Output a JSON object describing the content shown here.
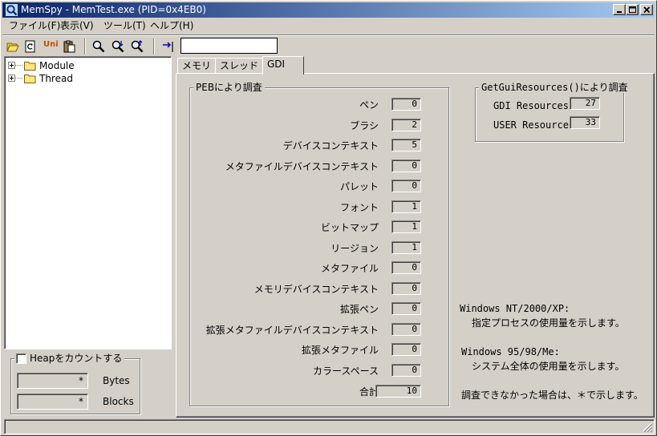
{
  "window": {
    "title": "MemSpy - MemTest.exe (PID=0x4EB0)"
  },
  "menu": [
    {
      "label": "ファイル(F)"
    },
    {
      "label": "表示(V)"
    },
    {
      "label": "ツール(T)"
    },
    {
      "label": "ヘルプ(H)"
    }
  ],
  "toolbar": {
    "icons": [
      "open-folder-icon",
      "refresh-icon",
      "unicode-icon",
      "paste-icon",
      "find-icon",
      "find-next-icon",
      "find-prev-icon",
      "goto-icon"
    ],
    "unicode_label": "Uni",
    "search_value": ""
  },
  "tree": {
    "items": [
      {
        "label": "Module"
      },
      {
        "label": "Thread"
      }
    ]
  },
  "heap": {
    "checkbox_label": "Heapをカウントする",
    "checked": false,
    "bytes_value": "*",
    "bytes_unit": "Bytes",
    "blocks_value": "*",
    "blocks_unit": "Blocks"
  },
  "tabs": [
    {
      "label": "メモリ",
      "active": false
    },
    {
      "label": "スレッド",
      "active": false
    },
    {
      "label": "GDI",
      "active": true
    }
  ],
  "peb_group": {
    "title": "PEBにより調査",
    "rows": [
      {
        "label": "ペン",
        "value": "0"
      },
      {
        "label": "ブラシ",
        "value": "2"
      },
      {
        "label": "デバイスコンテキスト",
        "value": "5"
      },
      {
        "label": "メタファイルデバイスコンテキスト",
        "value": "0"
      },
      {
        "label": "パレット",
        "value": "0"
      },
      {
        "label": "フォント",
        "value": "1"
      },
      {
        "label": "ビットマップ",
        "value": "1"
      },
      {
        "label": "リージョン",
        "value": "1"
      },
      {
        "label": "メタファイル",
        "value": "0"
      },
      {
        "label": "メモリデバイスコンテキスト",
        "value": "0"
      },
      {
        "label": "拡張ペン",
        "value": "0"
      },
      {
        "label": "拡張メタファイルデバイスコンテキスト",
        "value": "0"
      },
      {
        "label": "拡張メタファイル",
        "value": "0"
      },
      {
        "label": "カラースペース",
        "value": "0"
      }
    ],
    "total_label": "合計",
    "total_value": "10"
  },
  "gui_group": {
    "title": "GetGuiResources()により調査",
    "rows": [
      {
        "label": "GDI Resources",
        "value": "27"
      },
      {
        "label": "USER Resources",
        "value": "33"
      }
    ]
  },
  "notes": {
    "nt_heading": "Windows NT/2000/XP:",
    "nt_text": "指定プロセスの使用量を示します。",
    "win9x_heading": "Windows 95/98/Me:",
    "win9x_text": "システム全体の使用量を示します。",
    "fail_text": "調査できなかった場合は、＊で示します。"
  },
  "status": {
    "text": ""
  }
}
